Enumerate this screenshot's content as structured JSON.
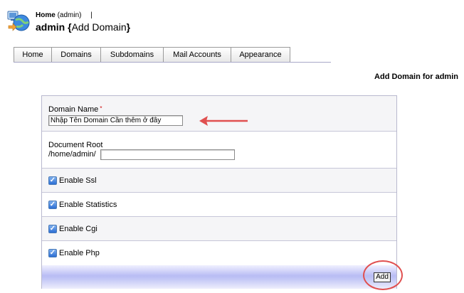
{
  "header": {
    "breadcrumb_home": "Home",
    "breadcrumb_user": "(admin)",
    "breadcrumb_sep": "|",
    "title_main": "admin",
    "title_open": "{",
    "title_sub": "Add Domain",
    "title_close": "}"
  },
  "tabs": [
    {
      "label": "Home"
    },
    {
      "label": "Domains"
    },
    {
      "label": "Subdomains"
    },
    {
      "label": "Mail Accounts"
    },
    {
      "label": "Appearance"
    }
  ],
  "section_title": "Add Domain for admin",
  "form": {
    "domain_name_label": "Domain Name",
    "required_mark": "*",
    "domain_name_value": "Nhập Tên Domain Cần thêm ở đây",
    "document_root_label": "Document Root",
    "document_root_prefix": "/home/admin/",
    "document_root_value": "",
    "checkboxes": [
      {
        "label": "Enable Ssl",
        "checked": true
      },
      {
        "label": "Enable Statistics",
        "checked": true
      },
      {
        "label": "Enable Cgi",
        "checked": true
      },
      {
        "label": "Enable Php",
        "checked": true
      }
    ],
    "check_glyph": "✓",
    "submit_label": "Add"
  },
  "colors": {
    "annotation": "#e05050",
    "footer_bar": "#b8bcf4",
    "checkbox": "#2c6ed4"
  },
  "icons": {
    "logo": "globe-computer-icon",
    "arrow": "arrow-left-annotation"
  }
}
